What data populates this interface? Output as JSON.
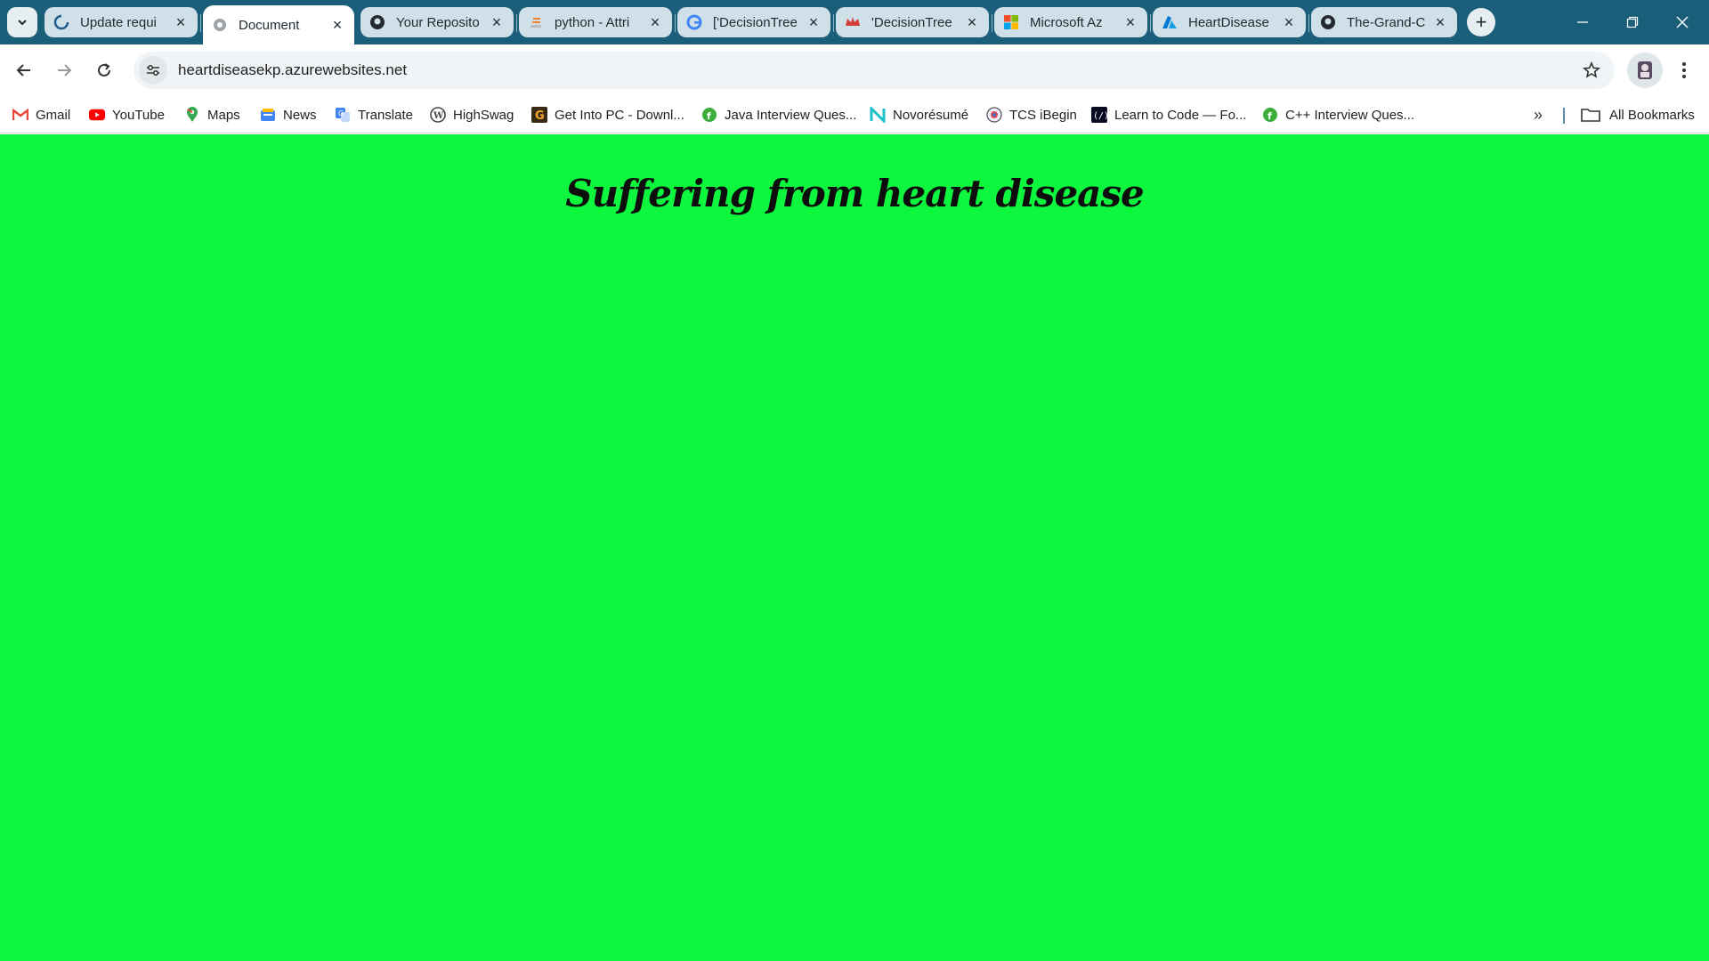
{
  "tabs": [
    {
      "title": "Update requi",
      "icon": "loading-icon"
    },
    {
      "title": "Document",
      "icon": "globe-icon",
      "active": true
    },
    {
      "title": "Your Reposito",
      "icon": "github-icon"
    },
    {
      "title": "python - Attri",
      "icon": "stackoverflow-icon"
    },
    {
      "title": "['DecisionTree",
      "icon": "google-icon"
    },
    {
      "title": "'DecisionTree",
      "icon": "crown-icon"
    },
    {
      "title": "Microsoft Az",
      "icon": "microsoft-icon"
    },
    {
      "title": "HeartDisease",
      "icon": "azure-icon"
    },
    {
      "title": "The-Grand-C",
      "icon": "github-icon"
    }
  ],
  "address_bar": {
    "url": "heartdiseasekp.azurewebsites.net"
  },
  "bookmarks": [
    {
      "label": "Gmail",
      "icon": "gmail-icon"
    },
    {
      "label": "YouTube",
      "icon": "youtube-icon"
    },
    {
      "label": "Maps",
      "icon": "maps-icon"
    },
    {
      "label": "News",
      "icon": "news-icon"
    },
    {
      "label": "Translate",
      "icon": "translate-icon"
    },
    {
      "label": "HighSwag",
      "icon": "wordpress-icon"
    },
    {
      "label": "Get Into PC - Downl...",
      "icon": "getintopc-icon"
    },
    {
      "label": "Java Interview Ques...",
      "icon": "interview-icon"
    },
    {
      "label": "Novorésumé",
      "icon": "novoresume-icon"
    },
    {
      "label": "TCS iBegin",
      "icon": "tcs-icon"
    },
    {
      "label": "Learn to Code — Fo...",
      "icon": "freecodecamp-icon"
    },
    {
      "label": "C++ Interview Ques...",
      "icon": "interview-icon"
    }
  ],
  "all_bookmarks_label": "All Bookmarks",
  "page": {
    "heading": "Suffering from heart disease",
    "background": "#0ef73f"
  }
}
